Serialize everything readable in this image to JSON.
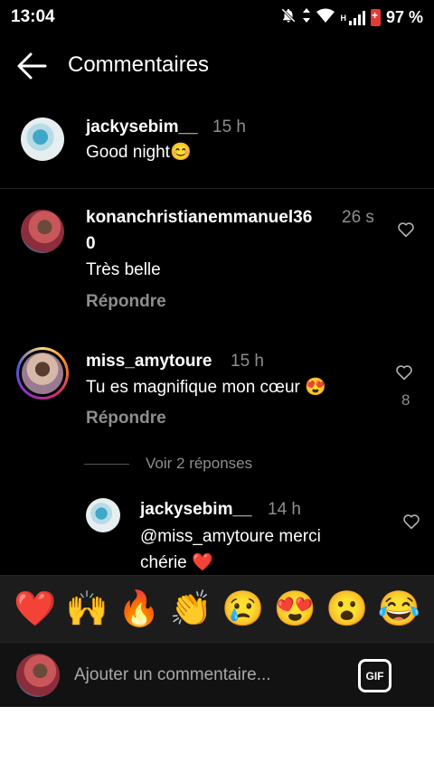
{
  "status_bar": {
    "time": "13:04",
    "network_type": "H",
    "battery": "97 %"
  },
  "header": {
    "title": "Commentaires"
  },
  "caption": {
    "username": "jackysebim__",
    "time": "15 h",
    "text": "Good night😊"
  },
  "comments": [
    {
      "username_line1": "konanchristianemmanuel36",
      "username_line2": "0",
      "time": "26 s",
      "text": "Très belle",
      "reply_label": "Répondre",
      "likes": ""
    },
    {
      "username_line1": "miss_amytoure",
      "time": "15 h",
      "text": "Tu es magnifique mon cœur 😍",
      "reply_label": "Répondre",
      "likes": "8",
      "view_replies": "Voir 2 réponses"
    }
  ],
  "reply": {
    "username": "jackysebim__",
    "time": "14 h",
    "text_line1": "@miss_amytoure merci",
    "text_line2": "chérie ❤️"
  },
  "emoji_bar": [
    "❤️",
    "🙌",
    "🔥",
    "👏",
    "😢",
    "😍",
    "😮",
    "😂"
  ],
  "input": {
    "placeholder": "Ajouter un commentaire...",
    "gif_label": "GIF"
  },
  "colors": {
    "background": "#000000",
    "secondary_text": "#8e8e8e",
    "heart": "#e8242f"
  }
}
